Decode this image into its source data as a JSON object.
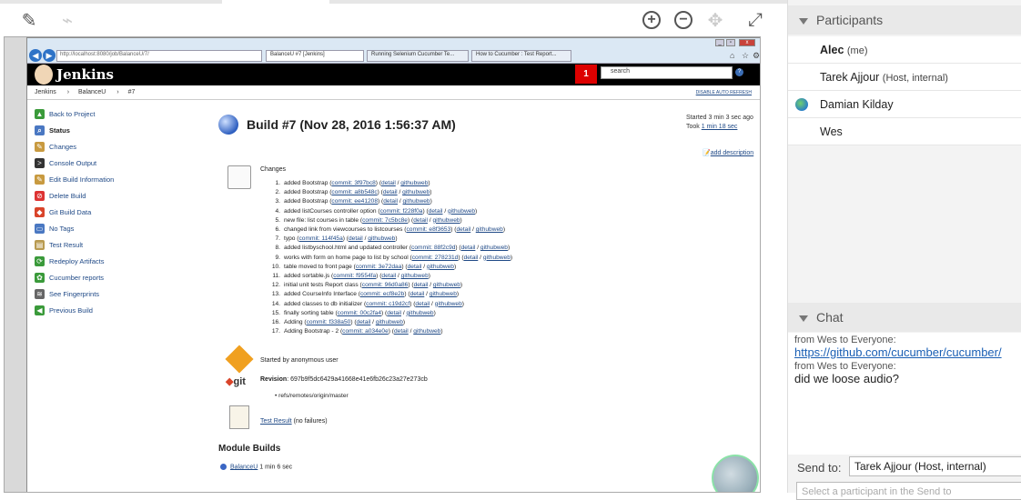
{
  "viewer": {
    "tools": [
      "pencil-icon",
      "laser-pointer-icon",
      "zoom-in-icon",
      "zoom-out-icon",
      "pan-icon",
      "fullscreen-icon"
    ]
  },
  "browser": {
    "url": "http://localhost:8080/job/BalanceU/7/",
    "tabs": [
      {
        "label": "BalanceU #7 [Jenkins]"
      },
      {
        "label": "Running Selenium Cucumber Te..."
      },
      {
        "label": "How to Cucumber : Test Report..."
      }
    ]
  },
  "jenkins": {
    "title": "Jenkins",
    "notification_count": "1",
    "search_placeholder": "search",
    "help": "?",
    "breadcrumb": [
      "Jenkins",
      "BalanceU",
      "#7"
    ],
    "disable_auto_refresh": "DISABLE AUTO REFRESH",
    "sidebar": [
      {
        "label": "Back to Project",
        "icon": "arrow-up-icon",
        "color": "#3a9a3a"
      },
      {
        "label": "Status",
        "icon": "search-icon",
        "color": "#4a78c2"
      },
      {
        "label": "Changes",
        "icon": "notepad-icon",
        "color": "#c89a40"
      },
      {
        "label": "Console Output",
        "icon": "terminal-icon",
        "color": "#333333"
      },
      {
        "label": "Edit Build Information",
        "icon": "notepad-icon",
        "color": "#c89a40"
      },
      {
        "label": "Delete Build",
        "icon": "no-entry-icon",
        "color": "#d33"
      },
      {
        "label": "Git Build Data",
        "icon": "git-icon",
        "color": "#d9442a"
      },
      {
        "label": "No Tags",
        "icon": "computer-icon",
        "color": "#4a78c2"
      },
      {
        "label": "Test Result",
        "icon": "clipboard-icon",
        "color": "#b89a50"
      },
      {
        "label": "Redeploy Artifacts",
        "icon": "redeploy-icon",
        "color": "#3a9a3a"
      },
      {
        "label": "Cucumber reports",
        "icon": "cucumber-icon",
        "color": "#3a9a3a"
      },
      {
        "label": "See Fingerprints",
        "icon": "fingerprint-icon",
        "color": "#666666"
      },
      {
        "label": "Previous Build",
        "icon": "arrow-left-icon",
        "color": "#3a9a3a"
      }
    ],
    "build_title": "Build #7 (Nov 28, 2016 1:56:37 AM)",
    "started": "Started 3 min 3 sec ago",
    "took_prefix": "Took ",
    "took": "1 min 18 sec",
    "add_description": "add description",
    "changes_label": "Changes",
    "changes": [
      {
        "n": "1.",
        "text": "added Bootstrap (",
        "commit": "commit: 3f97bc8",
        "end": ")"
      },
      {
        "n": "2.",
        "text": "added Bootstrap (",
        "commit": "commit: a8b548c",
        "end": ")"
      },
      {
        "n": "3.",
        "text": "added Bootstrap (",
        "commit": "commit: ee41208",
        "end": ")"
      },
      {
        "n": "4.",
        "text": "added listCourses controller option (",
        "commit": "commit: f228f0a",
        "end": ")"
      },
      {
        "n": "5.",
        "text": "new file: list courses in table (",
        "commit": "commit: 7c5bc8e",
        "end": ")"
      },
      {
        "n": "6.",
        "text": "changed link from viewcourses to listcourses (",
        "commit": "commit: e8f3653",
        "end": ")"
      },
      {
        "n": "7.",
        "text": "typo (",
        "commit": "commit: 114f45a",
        "end": ")"
      },
      {
        "n": "8.",
        "text": "added listbyschool.html and updated controller (",
        "commit": "commit: 88f2c9d",
        "end": ")"
      },
      {
        "n": "9.",
        "text": "works with form on home page to list by school (",
        "commit": "commit: 278231d",
        "end": ")"
      },
      {
        "n": "10.",
        "text": "table moved to front page (",
        "commit": "commit: 3e72daa",
        "end": ")"
      },
      {
        "n": "11.",
        "text": "added sortable.js (",
        "commit": "commit: f9554fa",
        "end": ")"
      },
      {
        "n": "12.",
        "text": "initial unit tests Report class (",
        "commit": "commit: 96d0a86",
        "end": ")"
      },
      {
        "n": "13.",
        "text": "added CourseInfo Interface (",
        "commit": "commit: ecf8e2b",
        "end": ")"
      },
      {
        "n": "14.",
        "text": "added classes to db initializer (",
        "commit": "commit: c19d2cf",
        "end": ")"
      },
      {
        "n": "15.",
        "text": "finally sorting table (",
        "commit": "commit: 00c2fa4",
        "end": ")"
      },
      {
        "n": "16.",
        "text": "Adding (",
        "commit": "commit: f338a50",
        "end": ")"
      },
      {
        "n": "17.",
        "text": "Adding Bootstrap - 2 (",
        "commit": "commit: a034e0e",
        "end": ")"
      }
    ],
    "detail": "detail",
    "githubweb": "githubweb",
    "started_by": "Started by anonymous user",
    "git_label": "git",
    "revision_label": "Revision",
    "revision": ": 697b9f5dc6429a41668e41e6fb26c23a27e273cb",
    "ref": "refs/remotes/origin/master",
    "test_result": "Test Result",
    "test_result_note": " (no failures)",
    "module_builds": "Module Builds",
    "module_name": "BalanceU",
    "module_time": " 1 min 6 sec"
  },
  "participants": {
    "header": "Participants",
    "items": [
      {
        "name": "Alec",
        "note": "(me)",
        "bold": true
      },
      {
        "name": "Tarek Ajjour",
        "note": "(Host, internal)"
      },
      {
        "name": "Damian Kilday",
        "note": "",
        "icon": "globe-icon"
      },
      {
        "name": "Wes",
        "note": ""
      }
    ]
  },
  "chat": {
    "header": "Chat",
    "messages": [
      {
        "from": "from Wes to Everyone:",
        "text": "https://github.com/cucumber/cucumber/",
        "link": true
      },
      {
        "from": "from Wes to Everyone:",
        "text": "did we loose audio?",
        "link": false
      }
    ],
    "send_to_label": "Send to:",
    "send_to_value": "Tarek Ajjour (Host, internal)",
    "input_placeholder": "Select a participant in the Send to"
  }
}
